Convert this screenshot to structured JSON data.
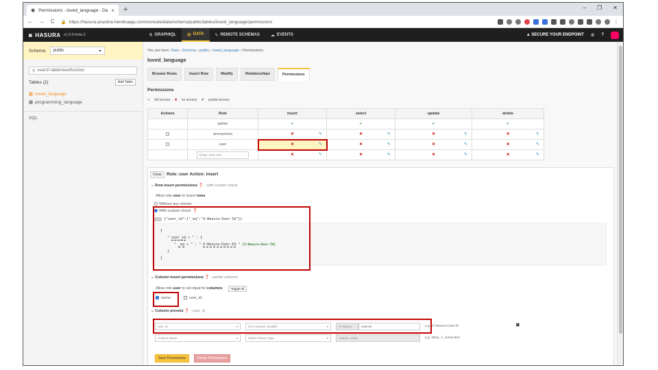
{
  "browser": {
    "tab_title": "Permissions - loved_language - Da",
    "url": "https://hasura-practice.herokuapp.com/console/data/schema/public/tables/loved_language/permissions"
  },
  "navbar": {
    "brand": "HASURA",
    "version": "v1.0.0-beta.2",
    "items": [
      "GRAPHIQL",
      "DATA",
      "REMOTE SCHEMAS",
      "EVENTS"
    ],
    "secure": "SECURE YOUR ENDPOINT"
  },
  "sidebar": {
    "schema_label": "Schema:",
    "schema_value": "public",
    "search_placeholder": "search table/view/function",
    "tables_label": "Tables (2)",
    "add_table": "Add Table",
    "tables": [
      "loved_language",
      "programming_language"
    ],
    "sql": "SQL"
  },
  "main": {
    "breadcrumb": {
      "prefix": "You are here:",
      "parts": [
        "Data",
        "Schema",
        "public",
        "loved_language",
        "Permissions"
      ]
    },
    "title": "loved_language",
    "tabs": [
      "Browse Rows",
      "Insert Row",
      "Modify",
      "Relationships",
      "Permissions"
    ],
    "permissions_heading": "Permissions",
    "legend": {
      "full": "full access",
      "none": "no access",
      "partial": "partial access"
    },
    "table": {
      "headers": [
        "Actions",
        "Role",
        "insert",
        "select",
        "update",
        "delete"
      ],
      "rows": [
        {
          "role": "admin"
        },
        {
          "role": "anonymous"
        },
        {
          "role": "user"
        }
      ],
      "new_role_placeholder": "Enter new role"
    },
    "edit": {
      "close": "Close",
      "role_action": "Role: user    Action: insert",
      "row_insert_heading": "Row insert permissions",
      "row_insert_note": "- with custom check",
      "allow_prefix": "Allow role",
      "allow_role": "user",
      "allow_middle": "to insert",
      "allow_obj": "rows",
      "opt_without": "Without any checks",
      "opt_custom": "With custom check:",
      "inline_json": "{\"user_id\":{\"_eq\":\"X-Hasura-User-Id\"}}",
      "builder_open": "{",
      "builder_col": "user_id",
      "builder_op": "_eq",
      "builder_val": "X-Hasura-User-Id",
      "builder_hint": "[X-Hasura-User-Id]",
      "builder_close": "}",
      "col_heading": "Column insert permissions",
      "col_note": "- partial columns",
      "col_allow_middle": "to set input for",
      "col_allow_obj": "columns",
      "toggle_all": "Toggle All",
      "columns": [
        {
          "name": "name",
          "checked": true
        },
        {
          "name": "user_id",
          "checked": false
        }
      ],
      "preset_heading": "Column presets",
      "preset_note": "- user_id",
      "preset1": {
        "column": "user_id",
        "type": "from session variable",
        "prefix": "X-Hasura-",
        "value": "User-Id",
        "eg": "e.g. X-Hasura-User-Id"
      },
      "preset2": {
        "column": "Column Name",
        "type": "Select Preset Type",
        "value": "column_value",
        "eg": "e.g. false, 1, some-text"
      },
      "save": "Save Permissions",
      "delete": "Delete Permissions"
    }
  }
}
